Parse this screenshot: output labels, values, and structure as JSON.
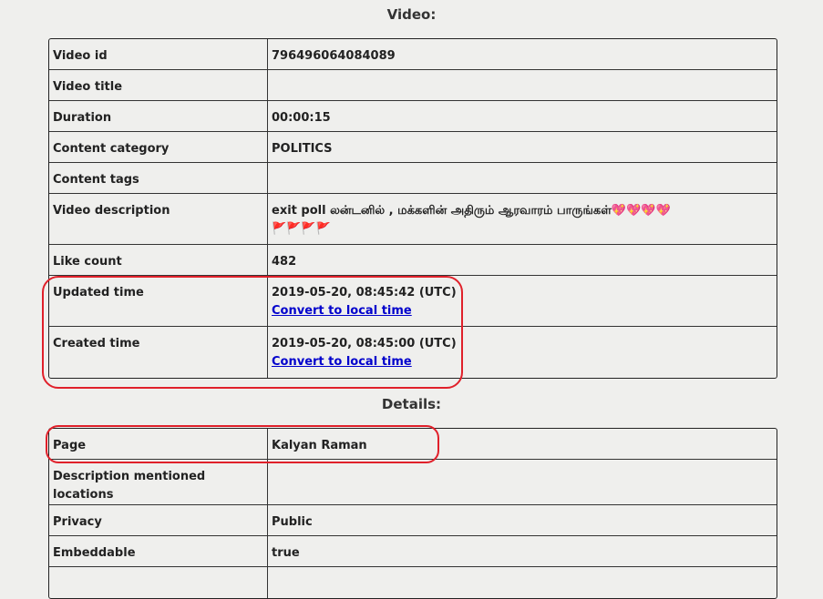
{
  "video_section": {
    "title": "Video:",
    "rows": [
      {
        "label": "Video id",
        "value": "796496064084089"
      },
      {
        "label": "Video title",
        "value": ""
      },
      {
        "label": "Duration",
        "value": "00:00:15"
      },
      {
        "label": "Content category",
        "value": "POLITICS"
      },
      {
        "label": "Content tags",
        "value": ""
      },
      {
        "label": "Video description",
        "value": "exit poll லன்டனில் , மக்களின் அதிரும் ஆரவாரம் பாருங்கள்",
        "hearts": "💖💖💖💖",
        "flags": "🚩🚩🚩🚩"
      },
      {
        "label": "Like count",
        "value": "482"
      },
      {
        "label": "Updated time",
        "value": "2019-05-20, 08:45:42 (UTC)",
        "link": "Convert to local time"
      },
      {
        "label": "Created time",
        "value": "2019-05-20, 08:45:00 (UTC)",
        "link": "Convert to local time"
      }
    ]
  },
  "details_section": {
    "title": "Details:",
    "rows": [
      {
        "label": "Page",
        "value": "Kalyan Raman"
      },
      {
        "label": "Description mentioned locations",
        "value": ""
      },
      {
        "label": "Privacy",
        "value": "Public"
      },
      {
        "label": "Embeddable",
        "value": "true"
      },
      {
        "label": "",
        "value": ""
      }
    ]
  },
  "annotation_color": "#e0202a",
  "link_color": "#0000cc"
}
